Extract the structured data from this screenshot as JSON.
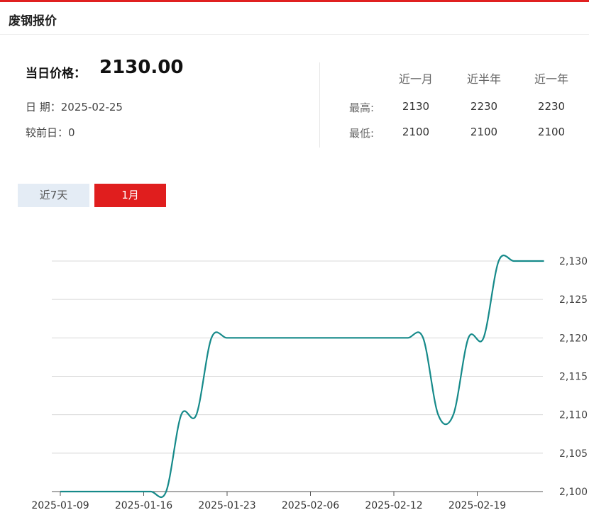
{
  "header": {
    "title": "废钢报价"
  },
  "price": {
    "label": "当日价格：",
    "value": "2130.00"
  },
  "info": {
    "date_line": "日 期：2025-02-25",
    "change_line": "较前日：0"
  },
  "stats": {
    "columns": [
      "近一月",
      "近半年",
      "近一年"
    ],
    "high_label": "最高:",
    "low_label": "最低:",
    "high": [
      "2130",
      "2230",
      "2230"
    ],
    "low": [
      "2100",
      "2100",
      "2100"
    ]
  },
  "range_buttons": {
    "seven_days": "近7天",
    "one_month": "1月",
    "active": "one_month"
  },
  "colors": {
    "accent": "#e01e1e",
    "line": "#168a8a",
    "inactive_button": "#e4ecf5"
  },
  "chart_data": {
    "type": "line",
    "x_ticks": [
      "2025-01-09",
      "2025-01-16",
      "2025-01-23",
      "2025-02-06",
      "2025-02-12",
      "2025-02-19"
    ],
    "y_ticks": [
      "2,100",
      "2,105",
      "2,110",
      "2,115",
      "2,120",
      "2,125",
      "2,130"
    ],
    "ylim": [
      2100,
      2130
    ],
    "y_axis_side": "right",
    "grid": "horizontal",
    "smooth": true,
    "series": [
      {
        "values": [
          2100,
          2100,
          2100,
          2100,
          2100,
          2100,
          2100,
          2100,
          2110,
          2110,
          2120,
          2120,
          2120,
          2120,
          2120,
          2120,
          2120,
          2120,
          2120,
          2120,
          2120,
          2120,
          2120,
          2120,
          2120,
          2110,
          2110,
          2120,
          2120,
          2130,
          2130,
          2130,
          2130
        ]
      }
    ]
  }
}
